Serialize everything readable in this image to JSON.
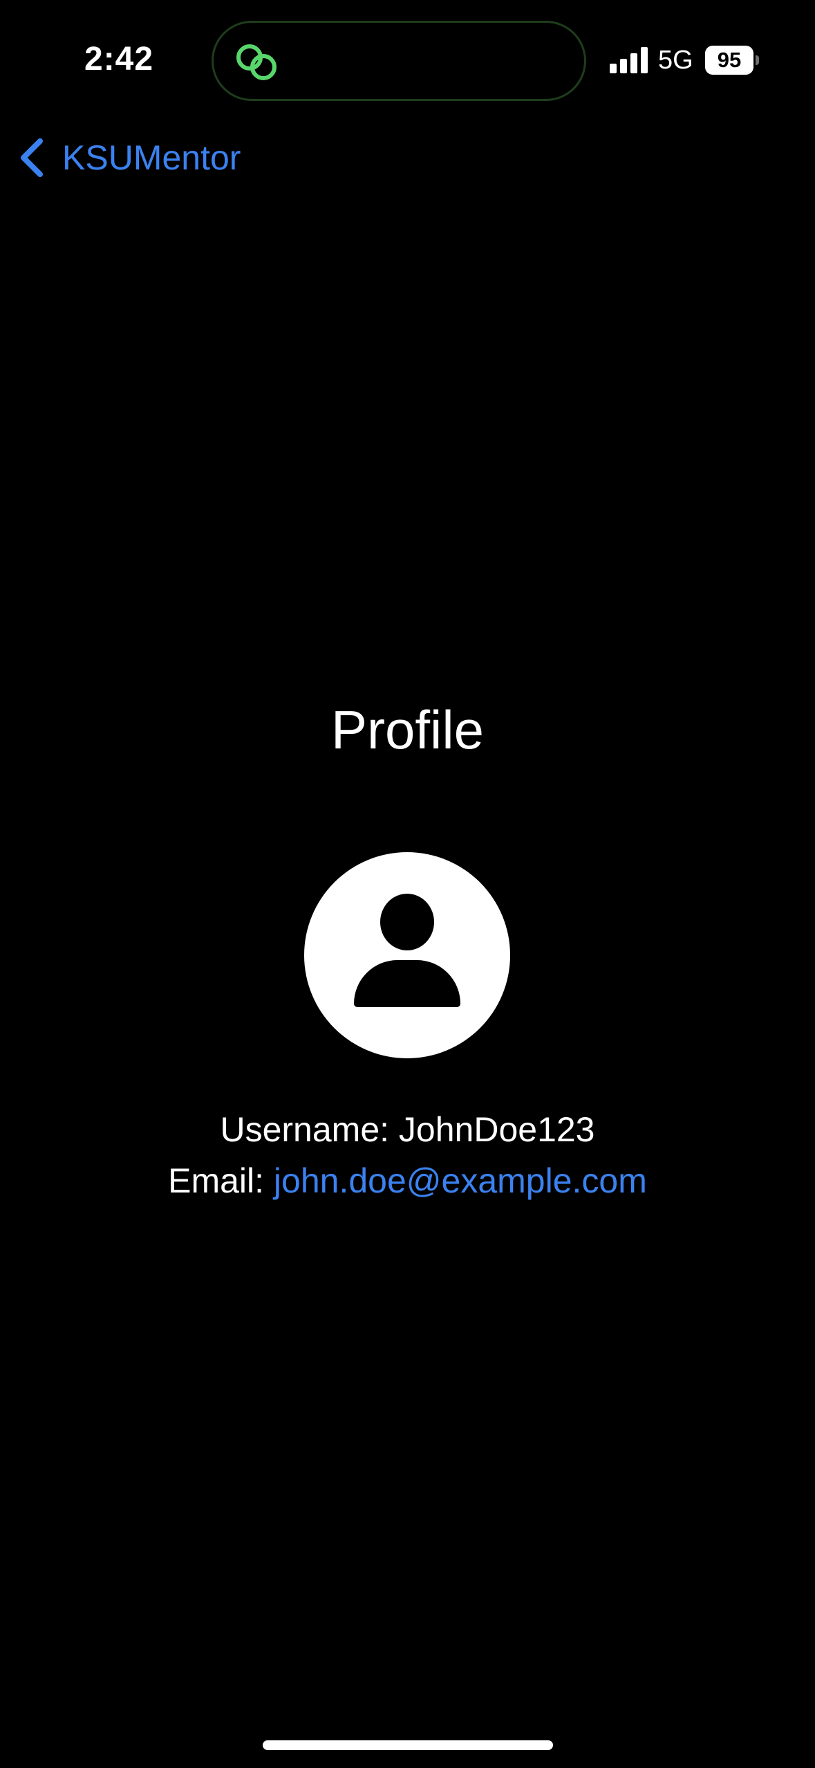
{
  "status_bar": {
    "time": "2:42",
    "network": "5G",
    "battery_level": "95",
    "activity_icon": "linked-rings-icon",
    "colors": {
      "activity_green": "#59d66b"
    }
  },
  "nav": {
    "back_label": "KSUMentor",
    "back_icon": "chevron-left-icon"
  },
  "main": {
    "title": "Profile",
    "avatar_icon": "person-icon",
    "username_label": "Username: ",
    "username_value": "JohnDoe123",
    "email_label": "Email: ",
    "email_value": "john.doe@example.com"
  },
  "colors": {
    "background": "#000000",
    "accent": "#3b82f0",
    "text": "#ffffff"
  }
}
